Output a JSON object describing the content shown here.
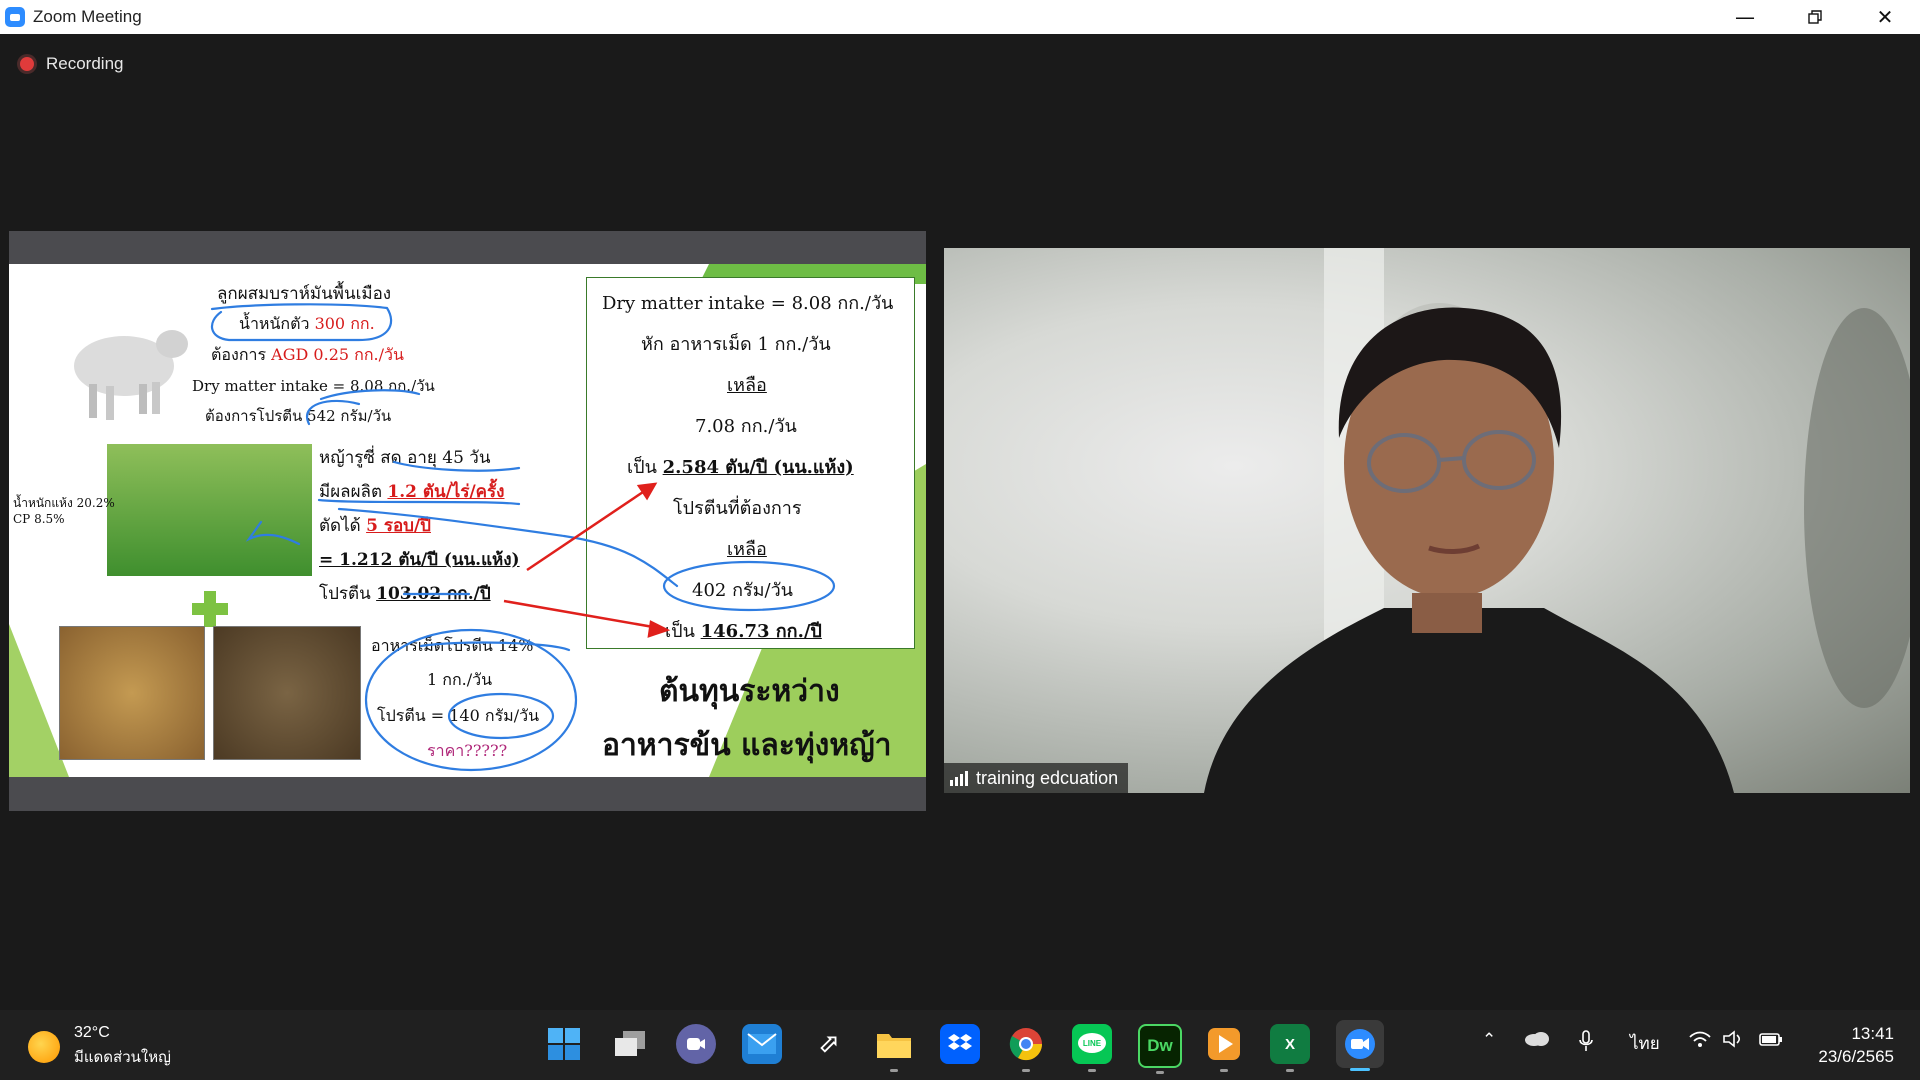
{
  "window": {
    "title": "Zoom Meeting"
  },
  "recording": {
    "label": "Recording"
  },
  "slide": {
    "cow_title": "ลูกผสมบราห์มันพื้นเมือง",
    "weight_label": "น้ำหนักตัว",
    "weight_value": "300 กก.",
    "agd_label": "ต้องการ",
    "agd_value": "AGD 0.25 กก./วัน",
    "dmi_line": "Dry matter intake = 8.08 กก./วัน",
    "protein_need": "ต้องการโปรตีน 542 กรัม/วัน",
    "grass_side_1": "น้ำหนักแห้ง 20.2%",
    "grass_side_2": "CP 8.5%",
    "grass_1": "หญ้ารูซี่ สด อายุ 45 วัน",
    "grass_2_a": "มีผลผลิต",
    "grass_2_b": "1.2 ตัน/ไร่/ครั้ง",
    "grass_3_a": "ตัดได้",
    "grass_3_b": "5 รอบ/ปี",
    "grass_4": "= 1.212 ตัน/ปี (นน.แห้ง)",
    "grass_5_a": "โปรตีน",
    "grass_5_b": "103.02 กก./ปี",
    "pellet_1": "อาหารเม็ดโปรตีน 14%",
    "pellet_2": "1 กก./วัน",
    "pellet_3": "โปรตีน = 140 กรัม/วัน",
    "pellet_4": "ราคา?????",
    "box_1": "Dry matter intake = 8.08 กก./วัน",
    "box_2": "หัก อาหารเม็ด 1 กก./วัน",
    "box_3": "เหลือ",
    "box_4": "7.08 กก./วัน",
    "box_5_a": "เป็น",
    "box_5_b": "2.584 ตัน/ปี (นน.แห้ง)",
    "box_6": "โปรตีนที่ต้องการ",
    "box_7": "เหลือ",
    "box_8": "402 กรัม/วัน",
    "box_9_a": "เป็น",
    "box_9_b": "146.73 กก./ปี",
    "headline_1": "ต้นทุนระหว่าง",
    "headline_2": "อาหารข้น และทุ่งหญ้า"
  },
  "participant": {
    "name": "training edcuation"
  },
  "taskbar": {
    "temperature": "32°C",
    "weather_desc": "มีแดดส่วนใหญ่",
    "language": "ไทย",
    "time": "13:41",
    "date": "23/6/2565",
    "apps": [
      "start-icon",
      "task-view-icon",
      "chat-icon",
      "mail-icon",
      "app-icon",
      "file-explorer-icon",
      "dropbox-icon",
      "chrome-icon",
      "line-icon",
      "dreamweaver-icon",
      "media-player-icon",
      "excel-icon",
      "zoom-icon"
    ]
  }
}
